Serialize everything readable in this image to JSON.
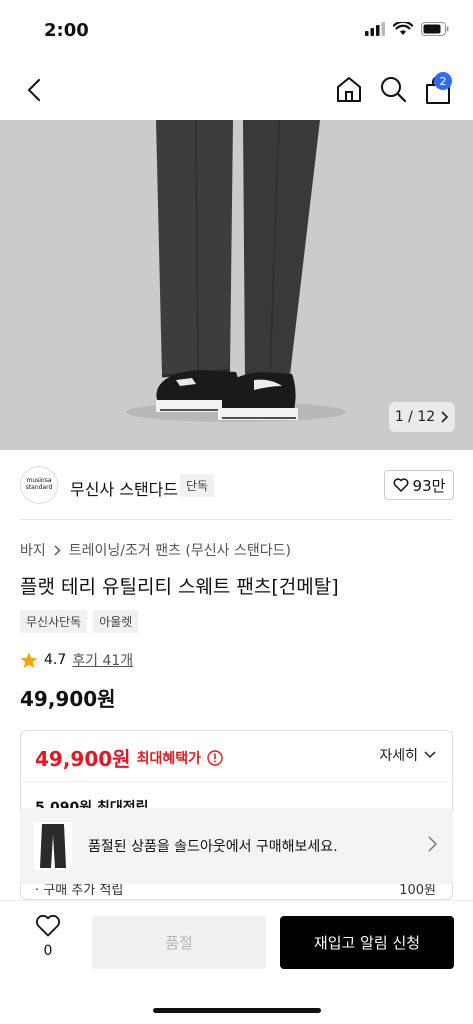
{
  "status_bar": {
    "time": "2:00"
  },
  "nav": {
    "cart_count": "2"
  },
  "gallery": {
    "counter": "1 / 12"
  },
  "brand": {
    "logo_text": "musinsa standard",
    "name": "무신사 스탠다드",
    "tag": "단독",
    "likes": "93만"
  },
  "breadcrumb": {
    "items": [
      "바지",
      "트레이닝/조거 팬츠 (무신사 스탠다드)"
    ]
  },
  "product": {
    "title": "플랫 테리 유틸리티 스웨트 팬츠[건메탈]",
    "tags": [
      "무신사단독",
      "아울렛"
    ],
    "rating": "4.7",
    "reviews": "후기 41개",
    "price": "49,900원"
  },
  "benefit": {
    "price": "49,900원",
    "label": "최대혜택가",
    "detail": "자세히",
    "line1": "5,090원 최대적립",
    "line2": "· 구매 추가 적립",
    "line2_value": "100원"
  },
  "soldout_banner": {
    "text": "품절된 상품을 솔드아웃에서 구매해보세요."
  },
  "bottom_bar": {
    "wish_count": "0",
    "soldout_label": "품절",
    "restock_label": "재입고 알림 신청"
  },
  "colors": {
    "accent_red": "#e01a22",
    "badge_blue": "#2f6bff",
    "primary_black": "#000000"
  }
}
